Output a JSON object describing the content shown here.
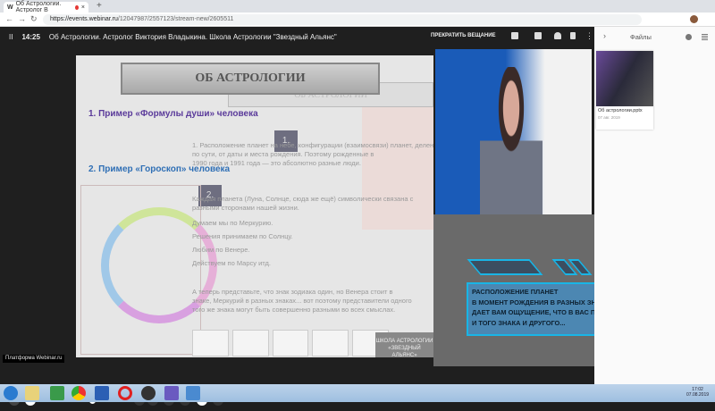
{
  "browser": {
    "tab_title": "Об Астрологии. Астролог В",
    "tab_close": "×",
    "new_tab": "+",
    "url_host": "https://events.webinar.ru",
    "url_path": "/12047987/2557123/stream-new/2605511",
    "back": "←",
    "forward": "→",
    "reload": "↻"
  },
  "player": {
    "pause": "II",
    "time": "14:25",
    "title": "Об Астрологии. Астролог Виктория Владыкина. Школа Астрологии \"Звездный Альянс\"",
    "stop_label": "ПРЕКРАТИТЬ ВЕЩАНИЕ",
    "more": "⋮"
  },
  "slide": {
    "title": "ОБ АСТРОЛОГИИ",
    "ghost_title": "ОБ АСТРОЛОГИИ",
    "heading1": "1. Пример «Формулы души» человека",
    "heading2": "2. Пример «Гороскоп» человека",
    "num1": "1.",
    "num2": "2.",
    "body": [
      "1. Расположение планет на небе, конфигурации (взаимосвязи) планет, деление круга на дома —",
      "по сути, от даты и места рождения. Поэтому рожденные в",
      "1990 года и 1991 года — это абсолютно разные люди.",
      "Каждая планета (Луна, Солнце, сюда же ещё) символически связана с",
      "разными сторонами нашей жизни.",
      "Думаем мы по Меркурию.",
      "Решения принимаем по Солнцу.",
      "Любим по Венере.",
      "Действуем по Марсу итд.",
      "А теперь представьте, что знак зодиака один, но Венера стоит в",
      "знаке, Меркурий в разных знаках... вот поэтому представители одного",
      "того же знака могут быть совершенно разными во всех смыслах."
    ],
    "school_badge": "ШКОЛА АСТРОЛОГИИ «ЗВЕЗДНЫЙ АЛЬЯНС»"
  },
  "overlay": {
    "lines": [
      "Расположение планет",
      "в момент рождения в разных знаках зодиака",
      "дает вам ощущение, что в вас присутствуют качества",
      " и того знака и другого..."
    ],
    "accent": "#19b5e6"
  },
  "controls": {
    "tooltip": "Платформа Webinar.ru",
    "prev": "‹",
    "next": "›",
    "volume_percent": 62
  },
  "files": {
    "title": "Файлы",
    "collapse": "›",
    "items": [
      {
        "name": "Об астрологии.pptx",
        "date": "07 авг. 2019"
      }
    ]
  },
  "taskbar": {
    "time": "17:02",
    "date": "07.08.2019"
  }
}
